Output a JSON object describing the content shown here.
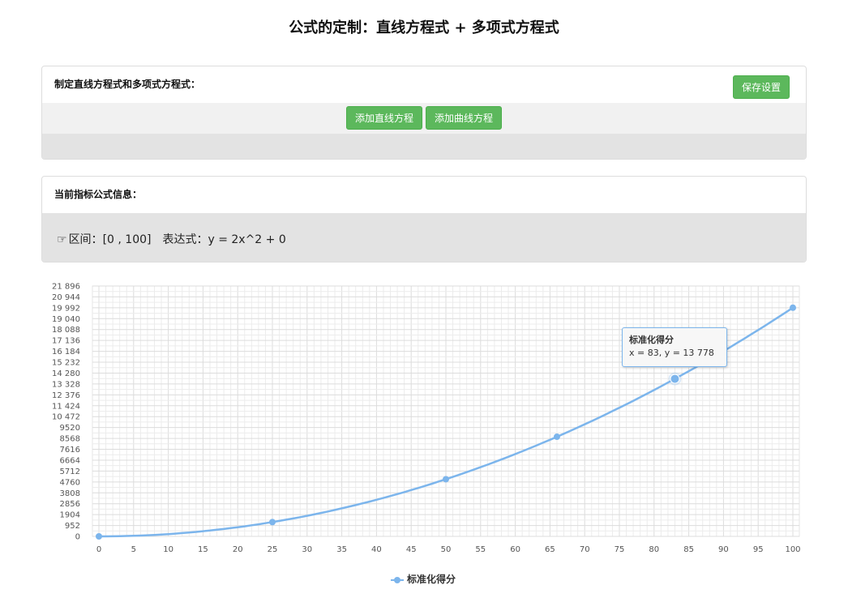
{
  "page": {
    "title": "公式的定制：直线方程式 + 多项式方程式"
  },
  "formula_panel": {
    "heading": "制定直线方程式和多项式方程式：",
    "save_label": "保存设置",
    "add_line_label": "添加直线方程",
    "add_curve_label": "添加曲线方程"
  },
  "info_panel": {
    "heading": "当前指标公式信息：",
    "hand_icon": "pointing-hand-icon",
    "interval_label": "区间：",
    "interval_value": "[0 , 100]",
    "expression_label": "表达式：",
    "expression_value": "y = 2x^2 + 0"
  },
  "tooltip": {
    "title": "标准化得分",
    "text": "x = 83, y = 13 778"
  },
  "legend": {
    "label": "标准化得分"
  },
  "colors": {
    "accent_green": "#5cb85c",
    "series_blue": "#7cb5ec",
    "grid": "#e6e6e6"
  },
  "chart_data": {
    "type": "line",
    "x_ticks": [
      0,
      5,
      10,
      15,
      20,
      25,
      30,
      35,
      40,
      45,
      50,
      55,
      60,
      65,
      70,
      75,
      80,
      85,
      90,
      95,
      100
    ],
    "y_ticks": [
      "0",
      "952",
      "1904",
      "2856",
      "3808",
      "4760",
      "5712",
      "6664",
      "7616",
      "8568",
      "9520",
      "10 472",
      "11 424",
      "12 376",
      "13 328",
      "14 280",
      "15 232",
      "16 184",
      "17 136",
      "18 088",
      "19 040",
      "19 992",
      "20 944",
      "21 896"
    ],
    "xlim": [
      0,
      100
    ],
    "ylim": [
      0,
      21896
    ],
    "grid": true,
    "legend_position": "bottom-center",
    "series": [
      {
        "name": "标准化得分",
        "expression": "y = 2x^2 + 0",
        "points": [
          {
            "x": 0,
            "y": 0
          },
          {
            "x": 25,
            "y": 1250
          },
          {
            "x": 50,
            "y": 5000
          },
          {
            "x": 66,
            "y": 8712
          },
          {
            "x": 83,
            "y": 13778
          },
          {
            "x": 100,
            "y": 20000
          }
        ],
        "highlighted_x": 83
      }
    ]
  }
}
